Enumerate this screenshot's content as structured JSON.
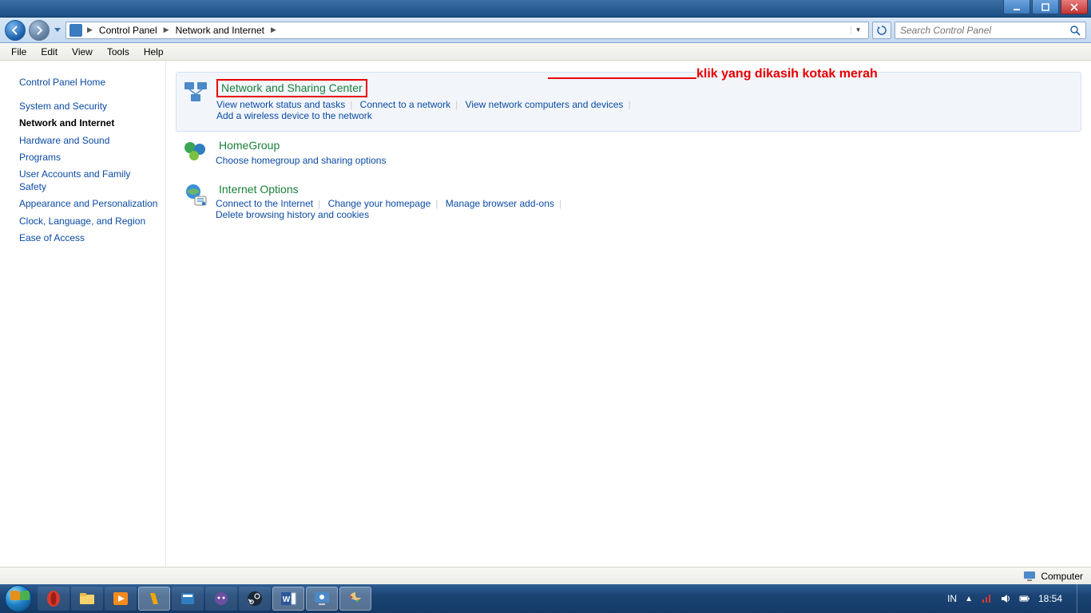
{
  "window_buttons": {
    "min": "minimize",
    "max": "maximize",
    "close": "close"
  },
  "breadcrumb": {
    "root": "Control Panel",
    "sub": "Network and Internet"
  },
  "search_placeholder": "Search Control Panel",
  "menu": {
    "file": "File",
    "edit": "Edit",
    "view": "View",
    "tools": "Tools",
    "help": "Help"
  },
  "sidebar": {
    "home": "Control Panel Home",
    "items": [
      "System and Security",
      "Network and Internet",
      "Hardware and Sound",
      "Programs",
      "User Accounts and Family Safety",
      "Appearance and Personalization",
      "Clock, Language, and Region",
      "Ease of Access"
    ]
  },
  "annotation": "klik yang dikasih kotak merah",
  "groups": [
    {
      "title": "Network and Sharing Center",
      "boxed": true,
      "highlighted": true,
      "links": [
        "View network status and tasks",
        "Connect to a network",
        "View network computers and devices",
        "Add a wireless device to the network"
      ]
    },
    {
      "title": "HomeGroup",
      "links": [
        "Choose homegroup and sharing options"
      ]
    },
    {
      "title": "Internet Options",
      "links": [
        "Connect to the Internet",
        "Change your homepage",
        "Manage browser add-ons",
        "Delete browsing history and cookies"
      ]
    }
  ],
  "status_bar": {
    "label": "Computer"
  },
  "tray": {
    "lang": "IN",
    "time": "18:54"
  }
}
